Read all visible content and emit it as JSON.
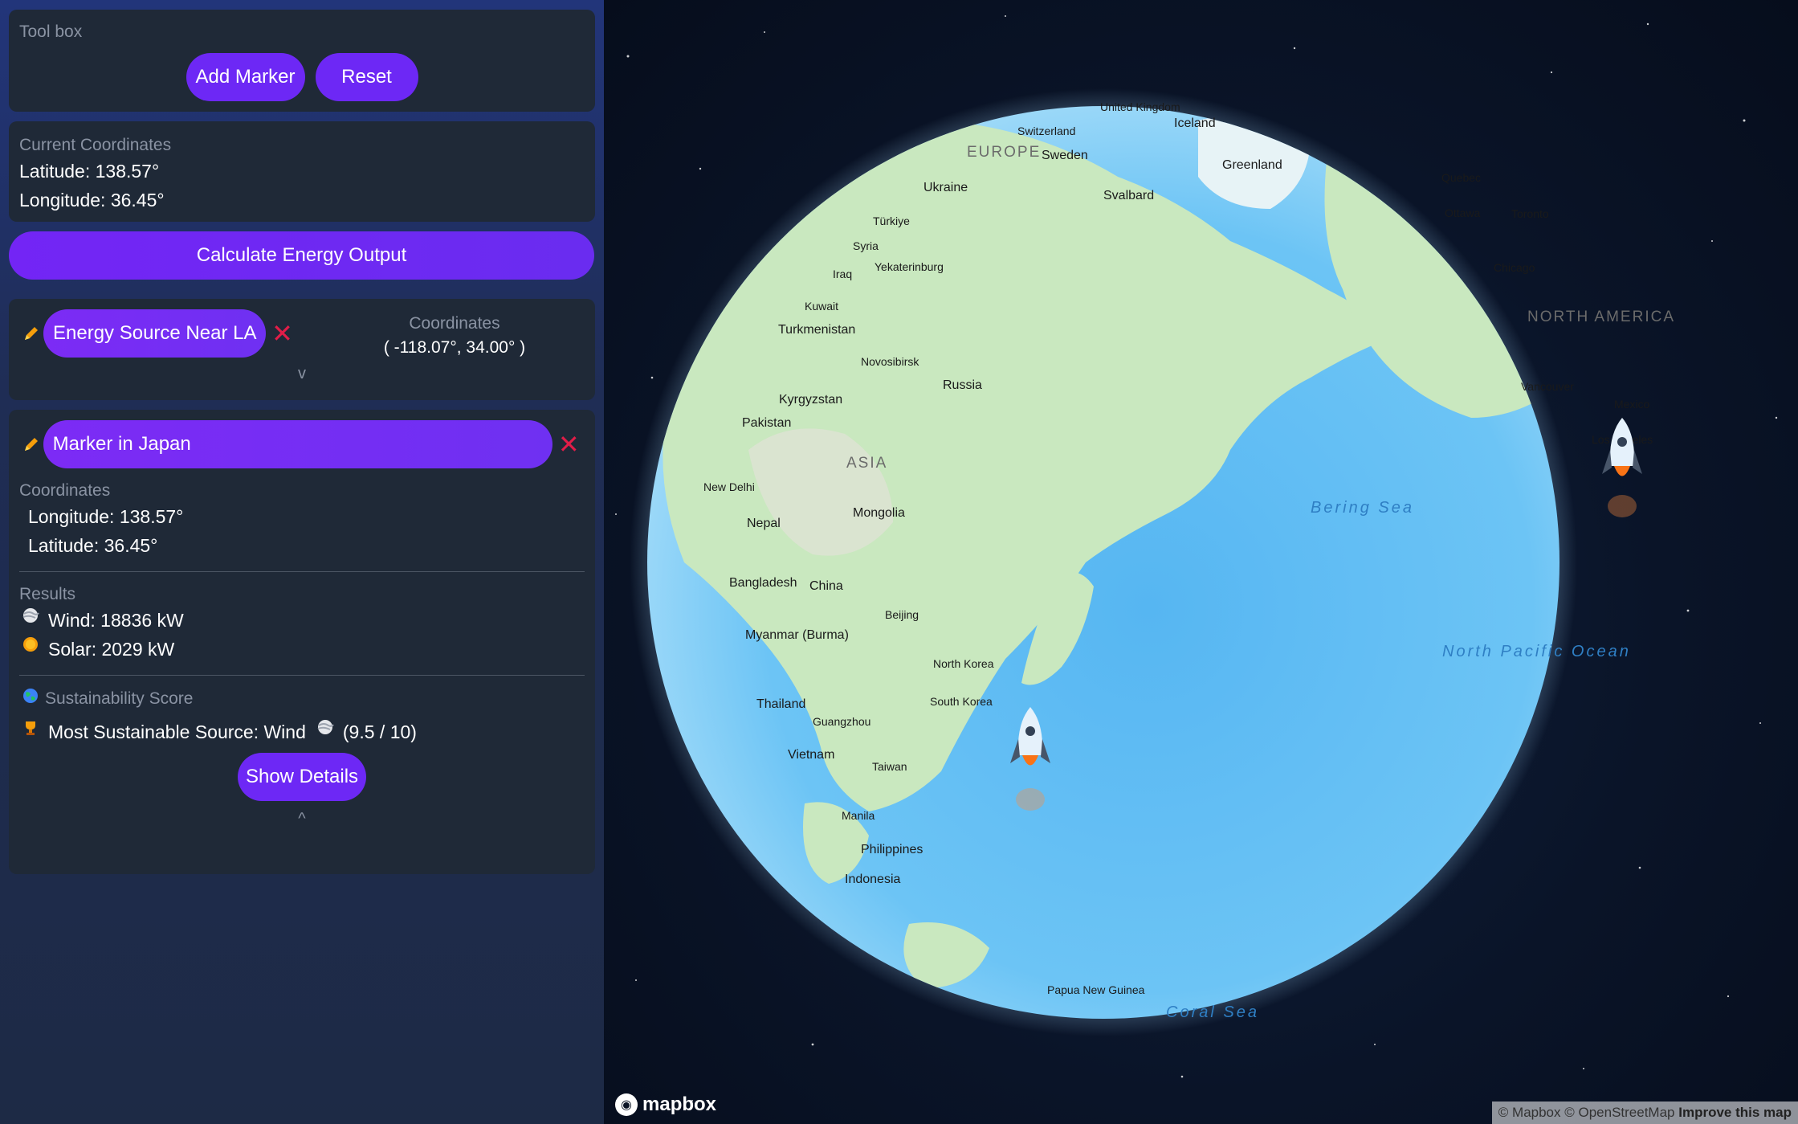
{
  "toolbox": {
    "title": "Tool box",
    "add_marker_label": "Add Marker",
    "reset_label": "Reset"
  },
  "current_coordinates": {
    "title": "Current Coordinates",
    "latitude": "Latitude: 138.57°",
    "longitude": "Longitude: 36.45°"
  },
  "calculate_label": "Calculate Energy Output",
  "markers": [
    {
      "name": "Energy Source Near LA",
      "coords_label": "Coordinates",
      "coords_value": "( -118.07°, 34.00° )",
      "toggle": "v"
    },
    {
      "name": "Marker in Japan",
      "coords_label": "Coordinates",
      "longitude": "Longitude: 138.57°",
      "latitude": "Latitude: 36.45°",
      "results_title": "Results",
      "wind": "Wind: 18836 kW",
      "solar": "Solar: 2029 kW",
      "sustainability_title": "Sustainability Score",
      "most_sustainable": "Most Sustainable Source: Wind",
      "score": "(9.5 / 10)",
      "show_details_label": "Show Details",
      "toggle": "^"
    }
  ],
  "icons": {
    "pencil": "pencil-icon",
    "close": "close-icon",
    "wind": "wind-icon",
    "sun": "sun-icon",
    "globe": "globe-icon",
    "trophy": "trophy-icon",
    "marker": "rocket-icon"
  },
  "map": {
    "labels": {
      "united_kingdom": "United Kingdom",
      "switzerland": "Switzerland",
      "iceland": "Iceland",
      "europe": "EUROPE",
      "sweden": "Sweden",
      "greenland": "Greenland",
      "quebec": "Quebec",
      "ottawa": "Ottawa",
      "toronto": "Toronto",
      "ukraine": "Ukraine",
      "svalbard": "Svalbard",
      "turkiye": "Türkiye",
      "chicago": "Chicago",
      "syria": "Syria",
      "iraq": "Iraq",
      "yekaterinburg": "Yekaterinburg",
      "north_america": "NORTH AMERICA",
      "kuwait": "Kuwait",
      "turkmenistan": "Turkmenistan",
      "novosibirsk": "Novosibirsk",
      "russia": "Russia",
      "vancouver": "Vancouver",
      "kyrgyzstan": "Kyrgyzstan",
      "pakistan": "Pakistan",
      "mexico": "Mexico",
      "los_angeles": "Los Angeles",
      "asia": "ASIA",
      "new_delhi": "New Delhi",
      "bering_sea": "Bering Sea",
      "mongolia": "Mongolia",
      "nepal": "Nepal",
      "bangladesh": "Bangladesh",
      "china": "China",
      "beijing": "Beijing",
      "myanmar": "Myanmar (Burma)",
      "north_pacific": "North Pacific Ocean",
      "north_korea": "North Korea",
      "south_korea": "South Korea",
      "thailand": "Thailand",
      "guangzhou": "Guangzhou",
      "vietnam": "Vietnam",
      "taiwan": "Taiwan",
      "manila": "Manila",
      "philippines": "Philippines",
      "indonesia": "Indonesia",
      "png": "Papua New Guinea",
      "coral_sea": "Coral Sea"
    },
    "logo": "mapbox",
    "attribution": "© Mapbox © OpenStreetMap",
    "improve": "Improve this map"
  },
  "colors": {
    "accent": "#6d28f5",
    "panel": "#1f2937",
    "close": "#e11d48",
    "pencil": "#f59e0b"
  }
}
